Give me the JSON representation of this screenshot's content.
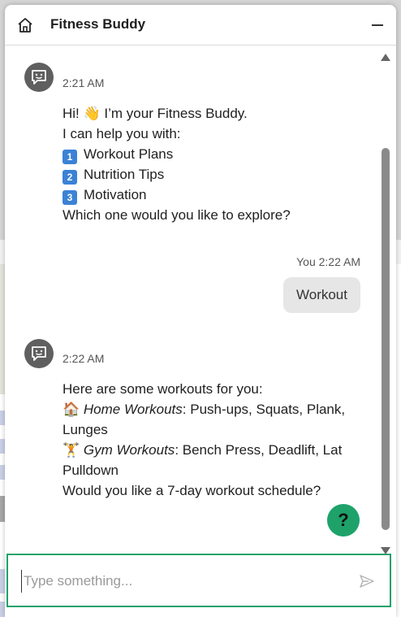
{
  "header": {
    "title": "Fitness Buddy",
    "home_icon": "home-icon",
    "minimize_icon": "minimize-icon"
  },
  "messages": [
    {
      "sender": "bot",
      "time": "2:21 AM",
      "lines": {
        "l1_pre": "Hi! ",
        "l1_emoji": "👋",
        "l1_post": " I’m your Fitness Buddy.",
        "l2": "I can help you with:",
        "opt1_num": "1",
        "opt1": "Workout Plans",
        "opt2_num": "2",
        "opt2": "Nutrition Tips",
        "opt3_num": "3",
        "opt3": "Motivation",
        "l6": "Which one would you like to explore?"
      }
    },
    {
      "sender": "user",
      "time": "You 2:22 AM",
      "text": "Workout"
    },
    {
      "sender": "bot",
      "time": "2:22 AM",
      "lines": {
        "l1": "Here are some workouts for you:",
        "home_emoji": "🏠",
        "home_label": "Home Workouts",
        "home_rest_a": ": Push-ups, Squats, Plank,",
        "home_rest_b": "Lunges",
        "gym_emoji": "🏋",
        "gym_label": "Gym Workouts",
        "gym_rest_a": ": Bench Press, Deadlift, Lat",
        "gym_rest_b": "Pulldown",
        "l_last": "Would you like a 7-day workout schedule?"
      }
    }
  ],
  "help_button": {
    "label": "?"
  },
  "composer": {
    "placeholder": "Type something...",
    "value": ""
  },
  "colors": {
    "accent": "#1ea26a",
    "avatar": "#5f5f5f",
    "user_bubble": "#e6e6e6"
  }
}
